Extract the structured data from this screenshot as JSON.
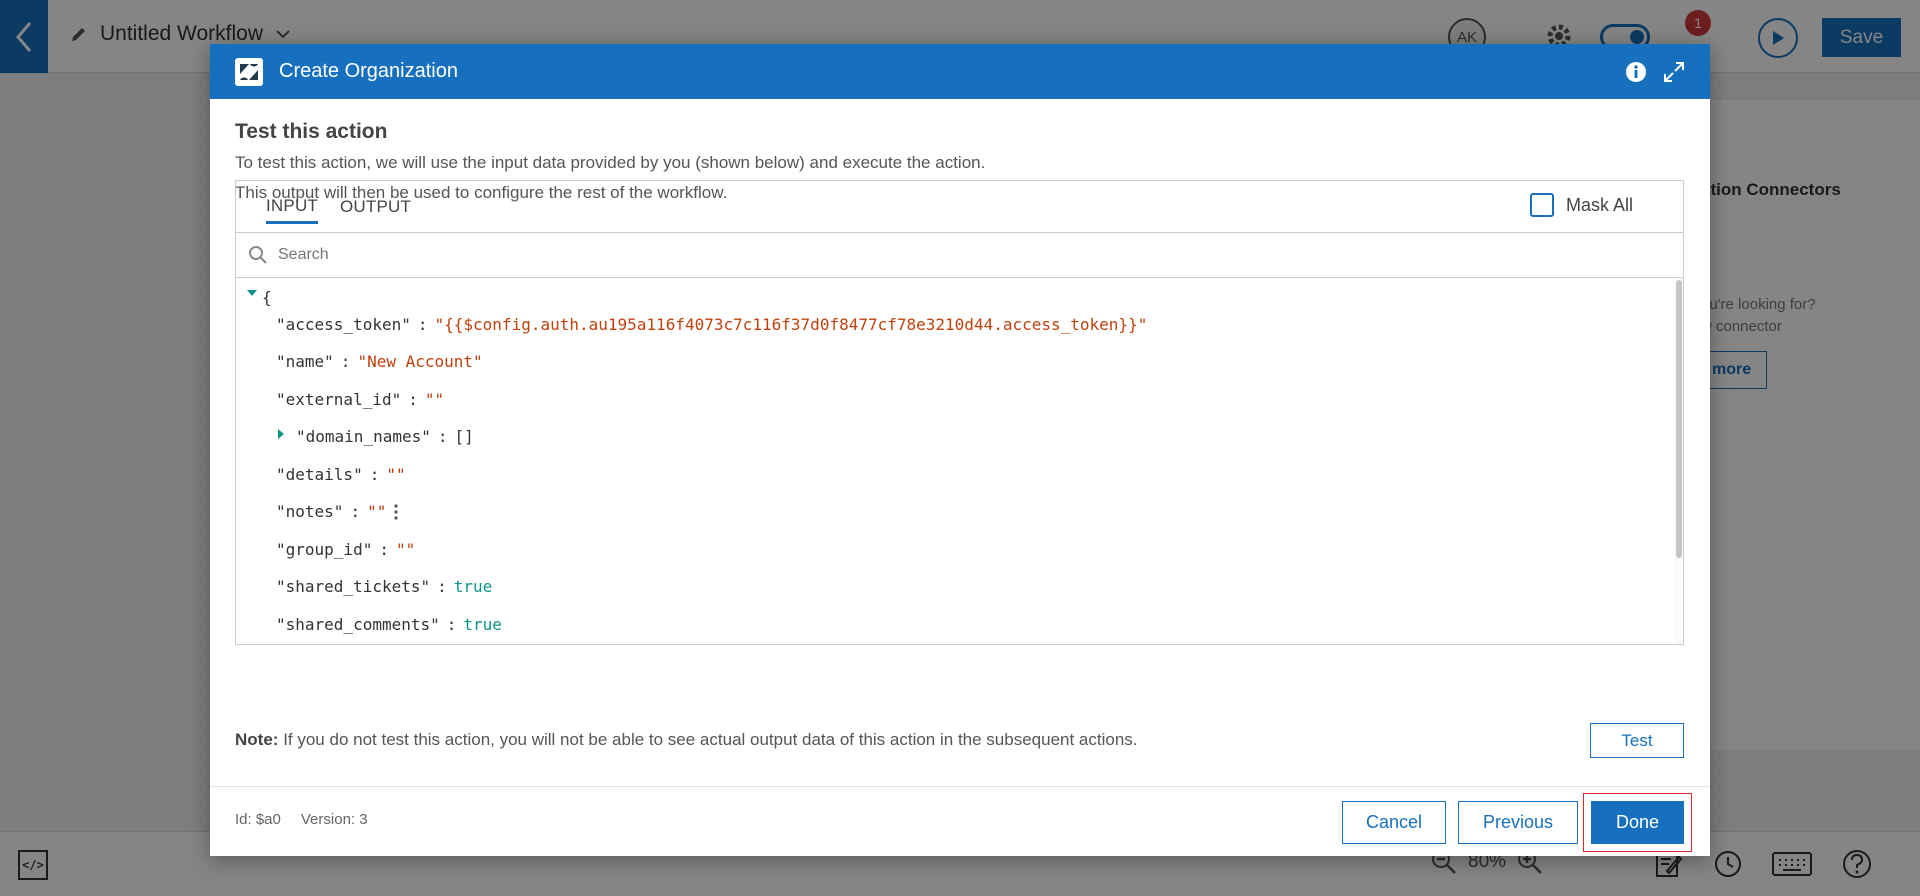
{
  "app": {
    "workflow_title": "Untitled Workflow",
    "avatar_initials": "AK",
    "notification_count": "1",
    "save_label": "Save",
    "side_panel": {
      "tab_label": "ation Connectors",
      "help_line1": "ou're looking for?",
      "help_line2": "w connector",
      "more_label": "more"
    },
    "zoom_level": "80%"
  },
  "modal": {
    "title": "Create Organization",
    "section_title": "Test this action",
    "desc_line1": "To test this action, we will use the input data provided by you (shown below) and execute the action.",
    "desc_line2": "This output will then be used to configure the rest of the workflow.",
    "tabs": [
      {
        "label": "INPUT",
        "active": true
      },
      {
        "label": "OUTPUT",
        "active": false
      }
    ],
    "mask_all_label": "Mask All",
    "search_placeholder": "Search",
    "json": {
      "open_brace": "{",
      "fields": [
        {
          "key": "\"access_token\"",
          "value": "\"{{$config.auth.au195a116f4073c7c116f37d0f8477cf78e3210d44.access_token}}\"",
          "type": "string"
        },
        {
          "key": "\"name\"",
          "value": "\"New Account\"",
          "type": "string"
        },
        {
          "key": "\"external_id\"",
          "value": "\"\"",
          "type": "string"
        },
        {
          "key": "\"domain_names\"",
          "value": "[]",
          "type": "array"
        },
        {
          "key": "\"details\"",
          "value": "\"\"",
          "type": "string"
        },
        {
          "key": "\"notes\"",
          "value": "\"\"",
          "type": "string"
        },
        {
          "key": "\"group_id\"",
          "value": "\"\"",
          "type": "string"
        },
        {
          "key": "\"shared_tickets\"",
          "value": "true",
          "type": "bool"
        },
        {
          "key": "\"shared_comments\"",
          "value": "true",
          "type": "bool"
        }
      ]
    },
    "note_label": "Note:",
    "note_text": "If you do not test this action, you will not be able to see actual output data of this action in the subsequent actions.",
    "test_label": "Test",
    "id_text": "Id: $a0",
    "version_text": "Version: 3",
    "cancel_label": "Cancel",
    "previous_label": "Previous",
    "done_label": "Done"
  },
  "colors": {
    "accent": "#1670be",
    "string_value": "#c2410c",
    "bool_value": "#0d9488",
    "highlight": "#e0242b"
  }
}
